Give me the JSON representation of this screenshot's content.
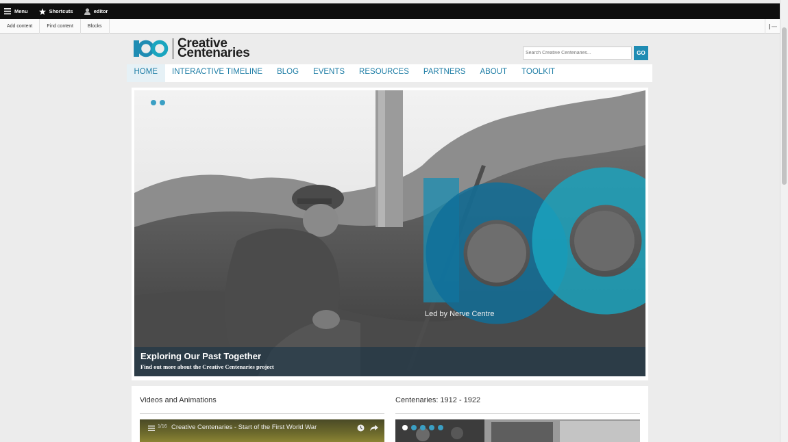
{
  "admin": {
    "menu_label": "Menu",
    "shortcuts_label": "Shortcuts",
    "user_label": "editor",
    "tray": [
      "Add content",
      "Find content",
      "Blocks"
    ]
  },
  "header": {
    "logo_line1": "Creative",
    "logo_line2": "Centenaries",
    "search_placeholder": "Search Creative Centenaries...",
    "search_button": "GO"
  },
  "nav": {
    "items": [
      "HOME",
      "INTERACTIVE TIMELINE",
      "BLOG",
      "EVENTS",
      "RESOURCES",
      "PARTNERS",
      "ABOUT",
      "TOOLKIT"
    ],
    "active_index": 0
  },
  "slider": {
    "credit": "Led by Nerve Centre",
    "caption_title": "Exploring Our Past Together",
    "caption_subtitle": "Find out more about the Creative Centenaries project"
  },
  "panels": {
    "left_title": "Videos and Animations",
    "video_count": "1/16",
    "video_title": "Creative Centenaries - Start of the First World War",
    "right_title": "Centenaries: 1912 - 1922"
  },
  "colors": {
    "brand_blue": "#1f8cb3",
    "nav_text": "#1f7ea6",
    "teal": "#1aa5bf"
  }
}
